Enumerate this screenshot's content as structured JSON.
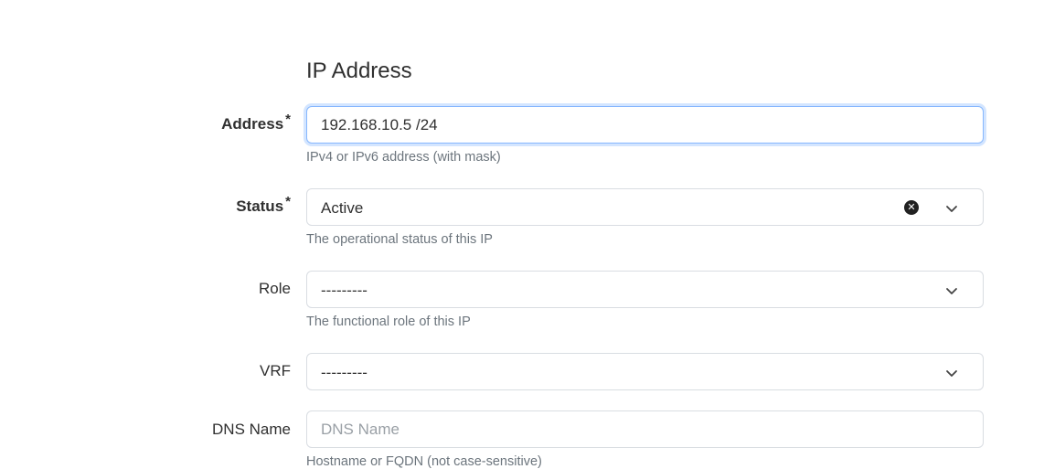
{
  "section_title": "IP Address",
  "address": {
    "label": "Address",
    "required_mark": "*",
    "value": "192.168.10.5 /24",
    "help": "IPv4 or IPv6 address (with mask)"
  },
  "status": {
    "label": "Status",
    "required_mark": "*",
    "value": "Active",
    "help": "The operational status of this IP"
  },
  "role": {
    "label": "Role",
    "value": "---------",
    "help": "The functional role of this IP"
  },
  "vrf": {
    "label": "VRF",
    "value": "---------"
  },
  "dns_name": {
    "label": "DNS Name",
    "placeholder": "DNS Name",
    "value": "",
    "help": "Hostname or FQDN (not case-sensitive)"
  },
  "colors": {
    "focus_border": "#86b7fe",
    "help_text": "#6c757d",
    "field_border": "#d9dde2"
  }
}
